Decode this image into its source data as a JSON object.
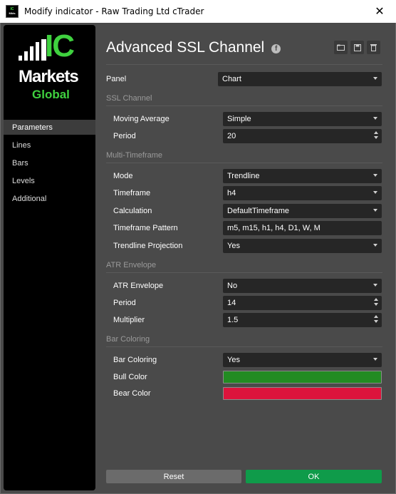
{
  "window": {
    "title": "Modify indicator - Raw Trading Ltd cTrader",
    "close_glyph": "✕"
  },
  "logo": {
    "line1": "IC",
    "line2": "Markets",
    "line3": "Global"
  },
  "nav": {
    "items": [
      {
        "label": "Parameters",
        "active": true
      },
      {
        "label": "Lines"
      },
      {
        "label": "Bars"
      },
      {
        "label": "Levels"
      },
      {
        "label": "Additional"
      }
    ]
  },
  "header": {
    "title": "Advanced SSL Channel",
    "fb_glyph": "f",
    "icons": [
      "folder-icon",
      "save-icon",
      "trash-icon"
    ]
  },
  "form": {
    "panel": {
      "label": "Panel",
      "value": "Chart"
    },
    "ssl_section": "SSL Channel",
    "moving_average": {
      "label": "Moving Average",
      "value": "Simple"
    },
    "period": {
      "label": "Period",
      "value": "20"
    },
    "mtf_section": "Multi-Timeframe",
    "mode": {
      "label": "Mode",
      "value": "Trendline"
    },
    "timeframe": {
      "label": "Timeframe",
      "value": "h4"
    },
    "calculation": {
      "label": "Calculation",
      "value": "DefaultTimeframe"
    },
    "timeframe_pattern": {
      "label": "Timeframe Pattern",
      "value": "m5, m15, h1, h4, D1, W, M"
    },
    "trendline_projection": {
      "label": "Trendline Projection",
      "value": "Yes"
    },
    "atr_section": "ATR Envelope",
    "atr_envelope": {
      "label": "ATR Envelope",
      "value": "No"
    },
    "atr_period": {
      "label": "Period",
      "value": "14"
    },
    "multiplier": {
      "label": "Multiplier",
      "value": "1.5"
    },
    "bar_section": "Bar Coloring",
    "bar_coloring": {
      "label": "Bar Coloring",
      "value": "Yes"
    },
    "bull_color": {
      "label": "Bull Color",
      "color": "#228b22"
    },
    "bear_color": {
      "label": "Bear Color",
      "color": "#dc143c"
    }
  },
  "footer": {
    "reset_label": "Reset",
    "ok_label": "OK"
  },
  "colors": {
    "ok": "#0f9b4a",
    "reset": "#6b6b6b",
    "brand_green": "#3fd13f"
  }
}
